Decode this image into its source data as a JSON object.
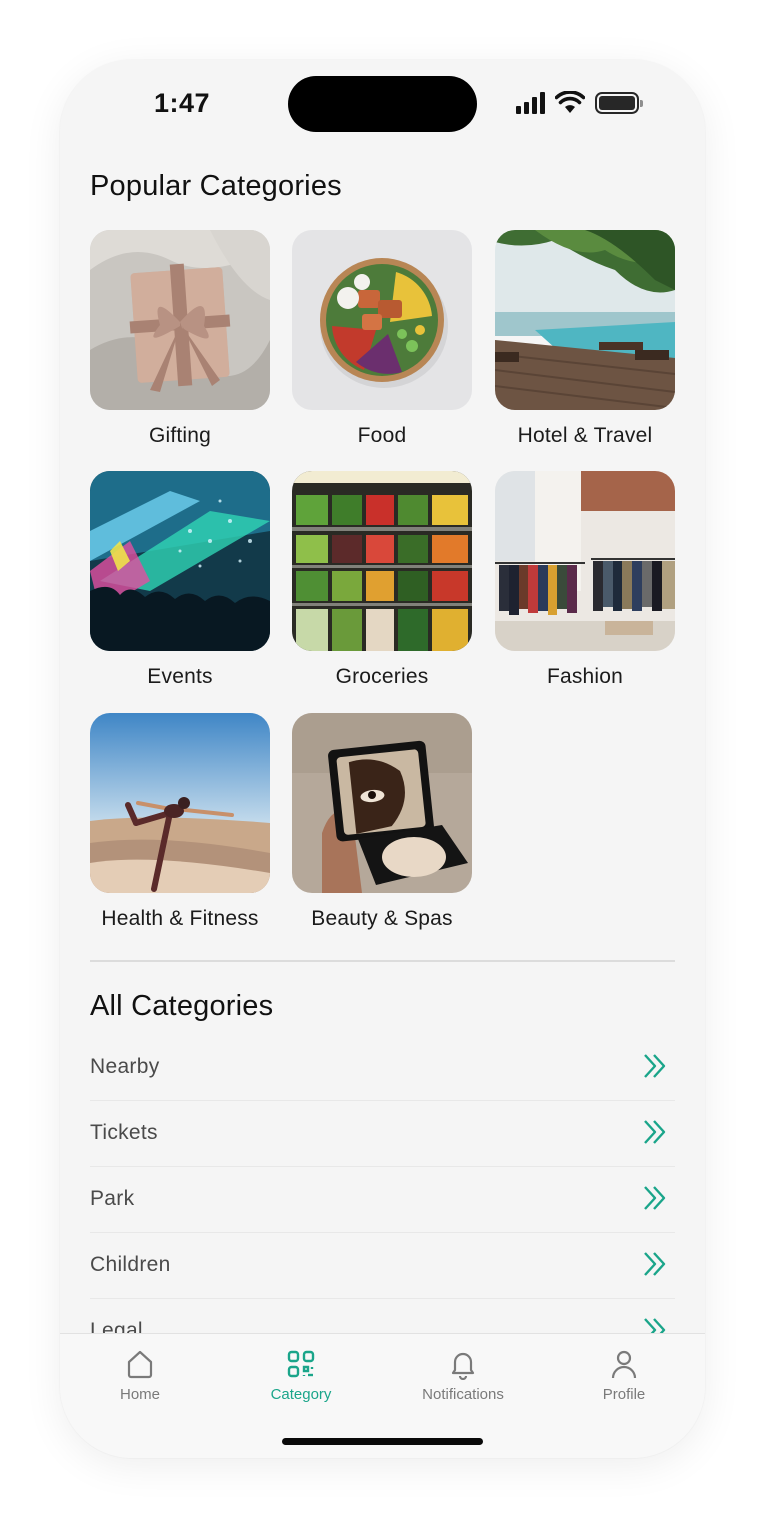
{
  "status_bar": {
    "time": "1:47"
  },
  "popular": {
    "title": "Popular Categories",
    "items": [
      {
        "label": "Gifting"
      },
      {
        "label": "Food"
      },
      {
        "label": "Hotel & Travel"
      },
      {
        "label": "Events"
      },
      {
        "label": "Groceries"
      },
      {
        "label": "Fashion"
      },
      {
        "label": "Health & Fitness"
      },
      {
        "label": "Beauty & Spas"
      }
    ]
  },
  "all": {
    "title": "All Categories",
    "items": [
      {
        "label": "Nearby"
      },
      {
        "label": "Tickets"
      },
      {
        "label": "Park"
      },
      {
        "label": "Children"
      },
      {
        "label": "Legal"
      }
    ]
  },
  "nav": {
    "items": [
      {
        "label": "Home",
        "icon": "home-icon"
      },
      {
        "label": "Category",
        "icon": "category-qr-icon"
      },
      {
        "label": "Notifications",
        "icon": "bell-icon"
      },
      {
        "label": "Profile",
        "icon": "user-icon"
      }
    ],
    "active_index": 1
  },
  "colors": {
    "accent": "#1aa58a",
    "background": "#f5f5f5"
  }
}
